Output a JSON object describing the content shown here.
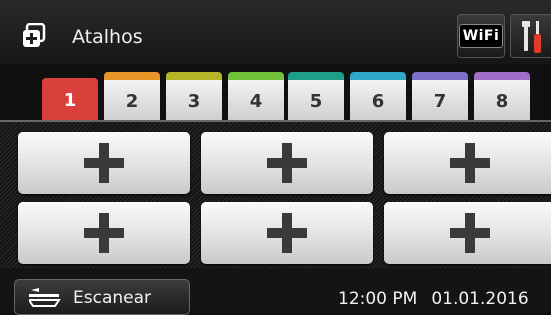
{
  "header": {
    "title": "Atalhos",
    "wifi_label": "WiFi",
    "settings_icon": "tools-icon"
  },
  "tabs": [
    {
      "label": "1",
      "color": "#d9403c",
      "active": true
    },
    {
      "label": "2",
      "color": "#e8962a"
    },
    {
      "label": "3",
      "color": "#b5b52a"
    },
    {
      "label": "4",
      "color": "#73c23a"
    },
    {
      "label": "5",
      "color": "#1f9e8a"
    },
    {
      "label": "6",
      "color": "#2fa7c9"
    },
    {
      "label": "7",
      "color": "#7b6fc7"
    },
    {
      "label": "8",
      "color": "#a36ec7"
    }
  ],
  "shortcut_buttons": [
    {
      "icon": "plus-icon"
    },
    {
      "icon": "plus-icon"
    },
    {
      "icon": "plus-icon"
    },
    {
      "icon": "plus-icon"
    },
    {
      "icon": "plus-icon"
    },
    {
      "icon": "plus-icon"
    }
  ],
  "footer": {
    "scan_label": "Escanear",
    "time": "12:00 PM",
    "date": "01.01.2016"
  }
}
